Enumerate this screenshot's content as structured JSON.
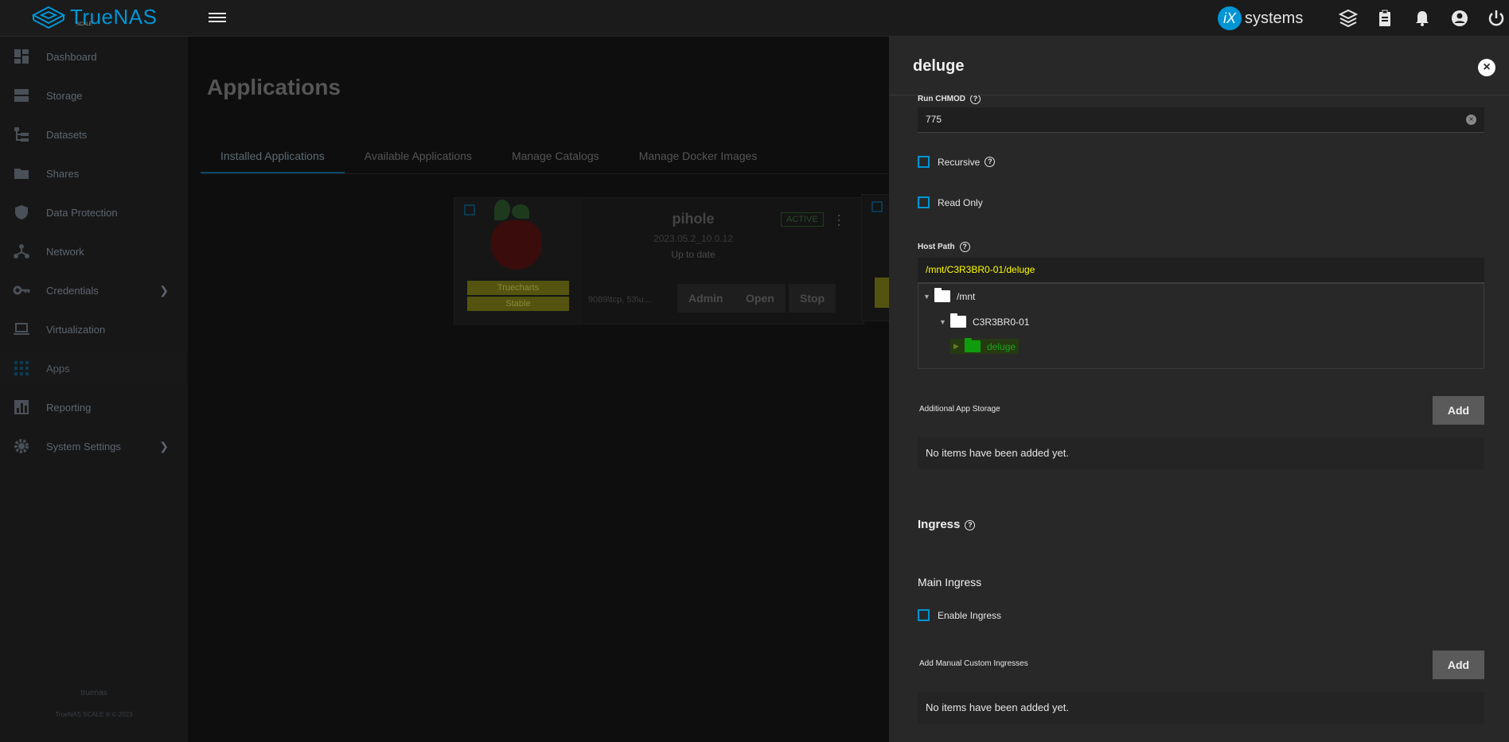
{
  "topbar": {
    "brand": "TrueNAS",
    "brand_sub": "SCALE",
    "vendor_mark": "iX",
    "vendor_text": "systems",
    "icons": [
      "truecommand-icon",
      "clipboard-icon",
      "bell-icon",
      "account-icon",
      "power-icon"
    ]
  },
  "sidebar": {
    "items": [
      {
        "label": "Dashboard",
        "icon": "dashboard-icon"
      },
      {
        "label": "Storage",
        "icon": "storage-icon"
      },
      {
        "label": "Datasets",
        "icon": "datasets-icon"
      },
      {
        "label": "Shares",
        "icon": "shares-icon"
      },
      {
        "label": "Data Protection",
        "icon": "shield-icon"
      },
      {
        "label": "Network",
        "icon": "network-icon"
      },
      {
        "label": "Credentials",
        "icon": "key-icon"
      },
      {
        "label": "Virtualization",
        "icon": "laptop-icon"
      },
      {
        "label": "Apps",
        "icon": "apps-icon"
      },
      {
        "label": "Reporting",
        "icon": "chart-icon"
      },
      {
        "label": "System Settings",
        "icon": "gear-icon"
      }
    ],
    "footer_host": "truenas",
    "footer_copy": "TrueNAS SCALE ® © 2023"
  },
  "main": {
    "title": "Applications",
    "tabs": [
      "Installed Applications",
      "Available Applications",
      "Manage Catalogs",
      "Manage Docker Images"
    ],
    "app_card": {
      "name": "pihole",
      "version": "2023.05.2_10.0.12",
      "update_status": "Up to date",
      "status": "ACTIVE",
      "catalog": "Truecharts",
      "train": "Stable",
      "ports": "9089\\tcp, 53\\u...",
      "buttons": [
        "Admin",
        "Open",
        "Stop"
      ]
    }
  },
  "panel": {
    "title": "deluge",
    "close_label": "×",
    "run_chmod_label": "Run CHMOD",
    "run_chmod_value": "775",
    "recursive_label": "Recursive",
    "readonly_label": "Read Only",
    "host_path_label": "Host Path",
    "host_path_value": "/mnt/C3R3BR0-01/deluge",
    "tree": {
      "root": "/mnt",
      "child": "C3R3BR0-01",
      "leaf": "deluge"
    },
    "additional_storage_label": "Additional App Storage",
    "add_label": "Add",
    "empty_text": "No items have been added yet.",
    "ingress_title": "Ingress",
    "main_ingress_title": "Main Ingress",
    "enable_ingress_label": "Enable Ingress",
    "manual_ingress_label": "Add Manual Custom Ingresses"
  },
  "colors": {
    "accent": "#0095d5",
    "panel_bg": "#282828",
    "highlight_path": "#ffff00",
    "folder_selected": "#0f9d0f"
  }
}
